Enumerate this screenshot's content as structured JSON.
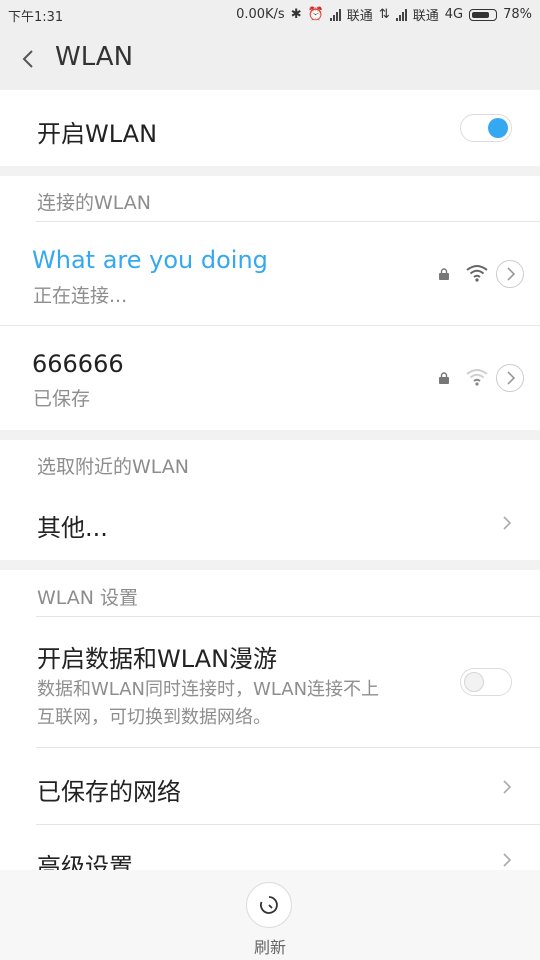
{
  "status": {
    "time": "下午1:31",
    "speed": "0.00K/s",
    "carrier1": "联通",
    "carrier2": "联通",
    "network": "4G",
    "battery": "78%",
    "battery_level": 0.78
  },
  "header": {
    "title": "WLAN"
  },
  "wlan_toggle": {
    "label": "开启WLAN",
    "on": true
  },
  "connected": {
    "header": "连接的WLAN",
    "networks": [
      {
        "name": "What are you doing",
        "status": "正在连接...",
        "color": "#35a8f2"
      },
      {
        "name": "666666",
        "status": "已保存",
        "color": "#222222"
      }
    ]
  },
  "nearby": {
    "header": "选取附近的WLAN",
    "other_label": "其他..."
  },
  "settings": {
    "header": "WLAN 设置",
    "roaming_title": "开启数据和WLAN漫游",
    "roaming_desc_1": "数据和WLAN同时连接时，WLAN连接不上",
    "roaming_desc_2": "互联网，可切换到数据网络。",
    "saved_networks": "已保存的网络",
    "advanced": "高级设置"
  },
  "refresh": {
    "label": "刷新"
  }
}
